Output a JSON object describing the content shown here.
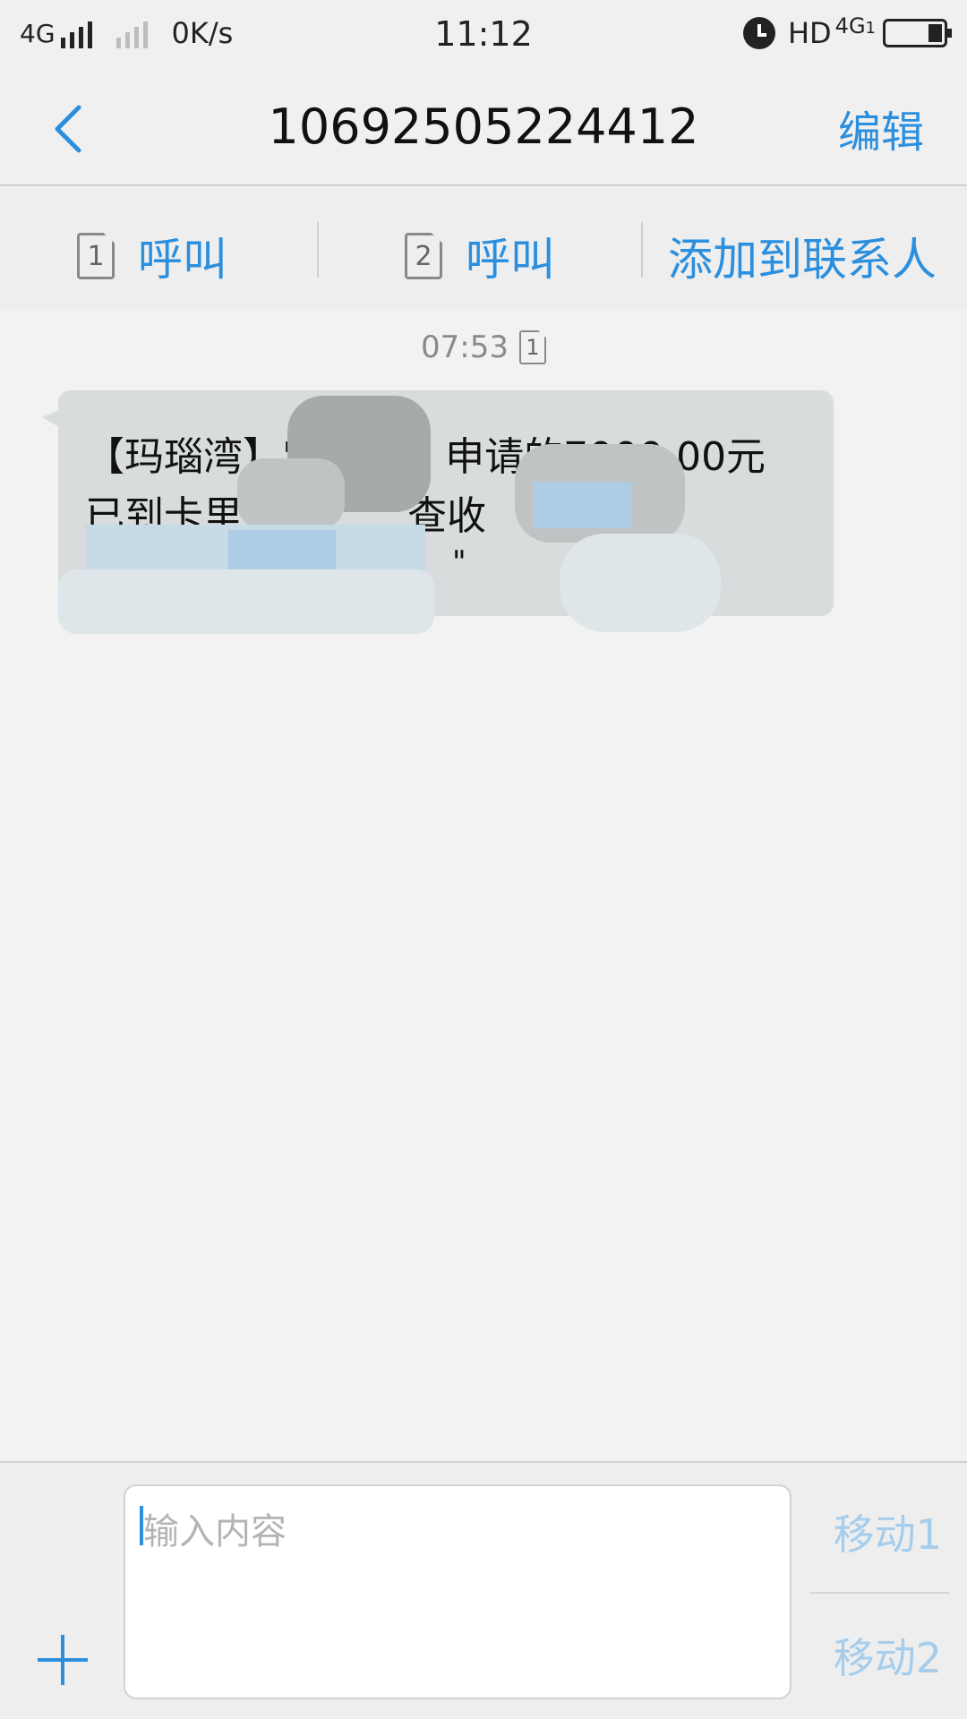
{
  "status_bar": {
    "network_left": "4G",
    "speed": "0K/s",
    "time": "11:12",
    "hd": "HD",
    "network_right": "4G",
    "network_right_sub": "1",
    "battery_level": 0.25
  },
  "header": {
    "title": "10692505224412",
    "edit_label": "编辑"
  },
  "actions": {
    "call1_sim": "1",
    "call1_label": "呼叫",
    "call2_sim": "2",
    "call2_label": "呼叫",
    "add_contact_label": "添加到联系人"
  },
  "message": {
    "time": "07:53",
    "sim": "1",
    "line1_prefix": "【玛瑙湾】'",
    "line1_suffix": "申请的7000.00元",
    "line2": "已到卡里，",
    "line2_suffix": "查收",
    "line3": "\""
  },
  "composer": {
    "placeholder": "输入内容",
    "send1_label": "移动1",
    "send2_label": "移动2"
  },
  "colors": {
    "accent": "#2b8fde",
    "send_disabled": "#a6cdeb",
    "bubble": "#d8dcdd"
  }
}
